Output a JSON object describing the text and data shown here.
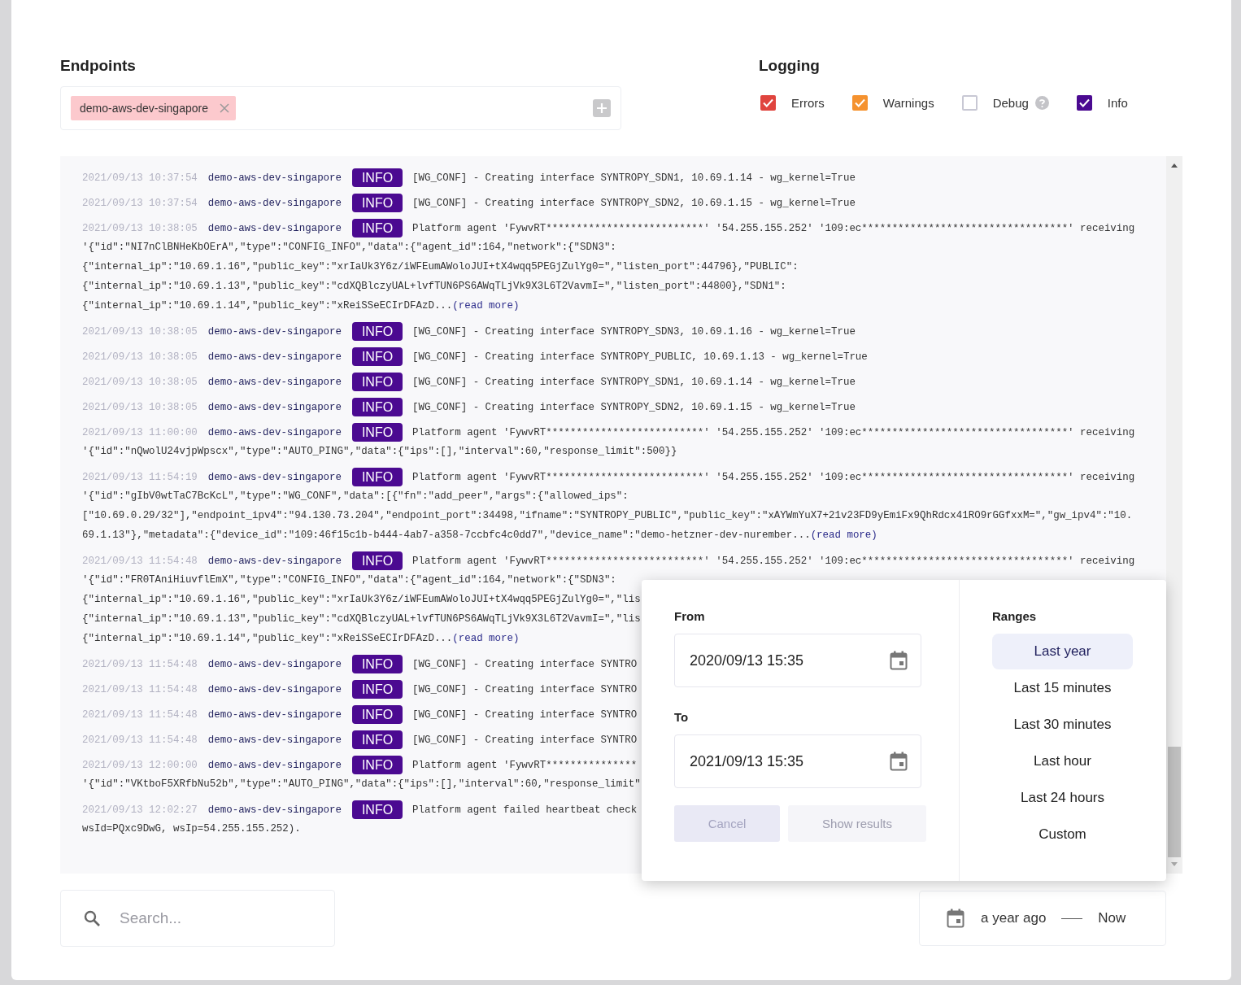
{
  "endpoints": {
    "title": "Endpoints",
    "tags": [
      {
        "label": "demo-aws-dev-singapore"
      }
    ]
  },
  "logging": {
    "title": "Logging",
    "options": [
      {
        "label": "Errors",
        "checked": true,
        "color": "#e0443e",
        "help": false
      },
      {
        "label": "Warnings",
        "checked": true,
        "color": "#f5922f",
        "help": false
      },
      {
        "label": "Debug",
        "checked": false,
        "help": true
      },
      {
        "label": "Info",
        "checked": true,
        "color": "#4b0a91",
        "help": false
      }
    ]
  },
  "log": {
    "entries": [
      {
        "time": "2021/09/13 10:37:54",
        "source": "demo-aws-dev-singapore",
        "level": "INFO",
        "lines": [
          "[WG_CONF] - Creating interface SYNTROPY_SDN1, 10.69.1.14 - wg_kernel=True"
        ]
      },
      {
        "time": "2021/09/13 10:37:54",
        "source": "demo-aws-dev-singapore",
        "level": "INFO",
        "lines": [
          "[WG_CONF] - Creating interface SYNTROPY_SDN2, 10.69.1.15 - wg_kernel=True"
        ]
      },
      {
        "time": "2021/09/13 10:38:05",
        "source": "demo-aws-dev-singapore",
        "level": "INFO",
        "lines": [
          "Platform agent 'FywvRT**************************' '54.255.155.252' '109:ec**********************************' receiving",
          "'{\"id\":\"NI7nClBNHeKbOErA\",\"type\":\"CONFIG_INFO\",\"data\":{\"agent_id\":164,\"network\":{\"SDN3\":",
          "{\"internal_ip\":\"10.69.1.16\",\"public_key\":\"xrIaUk3Y6z/iWFEumAWoloJUI+tX4wqq5PEGjZulYg0=\",\"listen_port\":44796},\"PUBLIC\":",
          "{\"internal_ip\":\"10.69.1.13\",\"public_key\":\"cdXQBlczyUAL+lvfTUN6PS6AWqTLjVk9X3L6T2VavmI=\",\"listen_port\":44800},\"SDN1\":",
          "{\"internal_ip\":\"10.69.1.14\",\"public_key\":\"xReiSSeECIrDFAzD..."
        ],
        "read_more": "(read more)"
      },
      {
        "time": "2021/09/13 10:38:05",
        "source": "demo-aws-dev-singapore",
        "level": "INFO",
        "lines": [
          "[WG_CONF] - Creating interface SYNTROPY_SDN3, 10.69.1.16 - wg_kernel=True"
        ]
      },
      {
        "time": "2021/09/13 10:38:05",
        "source": "demo-aws-dev-singapore",
        "level": "INFO",
        "lines": [
          "[WG_CONF] - Creating interface SYNTROPY_PUBLIC, 10.69.1.13 - wg_kernel=True"
        ]
      },
      {
        "time": "2021/09/13 10:38:05",
        "source": "demo-aws-dev-singapore",
        "level": "INFO",
        "lines": [
          "[WG_CONF] - Creating interface SYNTROPY_SDN1, 10.69.1.14 - wg_kernel=True"
        ]
      },
      {
        "time": "2021/09/13 10:38:05",
        "source": "demo-aws-dev-singapore",
        "level": "INFO",
        "lines": [
          "[WG_CONF] - Creating interface SYNTROPY_SDN2, 10.69.1.15 - wg_kernel=True"
        ]
      },
      {
        "time": "2021/09/13 11:00:00",
        "source": "demo-aws-dev-singapore",
        "level": "INFO",
        "lines": [
          "Platform agent 'FywvRT**************************' '54.255.155.252' '109:ec**********************************' receiving",
          "'{\"id\":\"nQwolU24vjpWpscx\",\"type\":\"AUTO_PING\",\"data\":{\"ips\":[],\"interval\":60,\"response_limit\":500}}"
        ]
      },
      {
        "time": "2021/09/13 11:54:19",
        "source": "demo-aws-dev-singapore",
        "level": "INFO",
        "lines": [
          "Platform agent 'FywvRT**************************' '54.255.155.252' '109:ec**********************************' receiving",
          "'{\"id\":\"gIbV0wtTaC7BcKcL\",\"type\":\"WG_CONF\",\"data\":[{\"fn\":\"add_peer\",\"args\":{\"allowed_ips\":",
          "[\"10.69.0.29/32\"],\"endpoint_ipv4\":\"94.130.73.204\",\"endpoint_port\":34498,\"ifname\":\"SYNTROPY_PUBLIC\",\"public_key\":\"xAYWmYuX7+21v23FD9yEmiFx9QhRdcx41RO9rGGfxxM=\",\"gw_ipv4\":\"10.",
          "69.1.13\"},\"metadata\":{\"device_id\":\"109:46f15c1b-b444-4ab7-a358-7ccbfc4c0dd7\",\"device_name\":\"demo-hetzner-dev-nurember..."
        ],
        "read_more": "(read more)"
      },
      {
        "time": "2021/09/13 11:54:48",
        "source": "demo-aws-dev-singapore",
        "level": "INFO",
        "lines": [
          "Platform agent 'FywvRT**************************' '54.255.155.252' '109:ec**********************************' receiving",
          "'{\"id\":\"FR0TAniHiuvflEmX\",\"type\":\"CONFIG_INFO\",\"data\":{\"agent_id\":164,\"network\":{\"SDN3\":",
          "{\"internal_ip\":\"10.69.1.16\",\"public_key\":\"xrIaUk3Y6z/iWFEumAWoloJUI+tX4wqq5PEGjZulYg0=\",\"lis",
          "{\"internal_ip\":\"10.69.1.13\",\"public_key\":\"cdXQBlczyUAL+lvfTUN6PS6AWqTLjVk9X3L6T2VavmI=\",\"lis",
          "{\"internal_ip\":\"10.69.1.14\",\"public_key\":\"xReiSSeECIrDFAzD..."
        ],
        "read_more": "(read more)"
      },
      {
        "time": "2021/09/13 11:54:48",
        "source": "demo-aws-dev-singapore",
        "level": "INFO",
        "lines": [
          "[WG_CONF] - Creating interface SYNTRO"
        ]
      },
      {
        "time": "2021/09/13 11:54:48",
        "source": "demo-aws-dev-singapore",
        "level": "INFO",
        "lines": [
          "[WG_CONF] - Creating interface SYNTRO"
        ]
      },
      {
        "time": "2021/09/13 11:54:48",
        "source": "demo-aws-dev-singapore",
        "level": "INFO",
        "lines": [
          "[WG_CONF] - Creating interface SYNTRO"
        ]
      },
      {
        "time": "2021/09/13 11:54:48",
        "source": "demo-aws-dev-singapore",
        "level": "INFO",
        "lines": [
          "[WG_CONF] - Creating interface SYNTRO"
        ]
      },
      {
        "time": "2021/09/13 12:00:00",
        "source": "demo-aws-dev-singapore",
        "level": "INFO",
        "lines": [
          "Platform agent 'FywvRT***************",
          "'{\"id\":\"VKtboF5XRfbNu52b\",\"type\":\"AUTO_PING\",\"data\":{\"ips\":[],\"interval\":60,\"response_limit\""
        ]
      },
      {
        "time": "2021/09/13 12:02:27",
        "source": "demo-aws-dev-singapore",
        "level": "INFO",
        "lines": [
          "Platform agent failed heartbeat check",
          "wsId=PQxc9DwG, wsIp=54.255.155.252)."
        ]
      }
    ]
  },
  "search": {
    "placeholder": "Search..."
  },
  "range_button": {
    "from": "a year ago",
    "to": "Now"
  },
  "date_popover": {
    "from_label": "From",
    "from_value": "2020/09/13 15:35",
    "to_label": "To",
    "to_value": "2021/09/13 15:35",
    "buttons": [
      {
        "label": "Cancel",
        "disabled": false
      },
      {
        "label": "Show results",
        "disabled": true
      }
    ],
    "ranges_title": "Ranges",
    "ranges": [
      {
        "label": "Last year",
        "selected": true
      },
      {
        "label": "Last 15 minutes",
        "selected": false
      },
      {
        "label": "Last 30 minutes",
        "selected": false
      },
      {
        "label": "Last hour",
        "selected": false
      },
      {
        "label": "Last 24 hours",
        "selected": false
      },
      {
        "label": "Custom",
        "selected": false
      }
    ]
  }
}
